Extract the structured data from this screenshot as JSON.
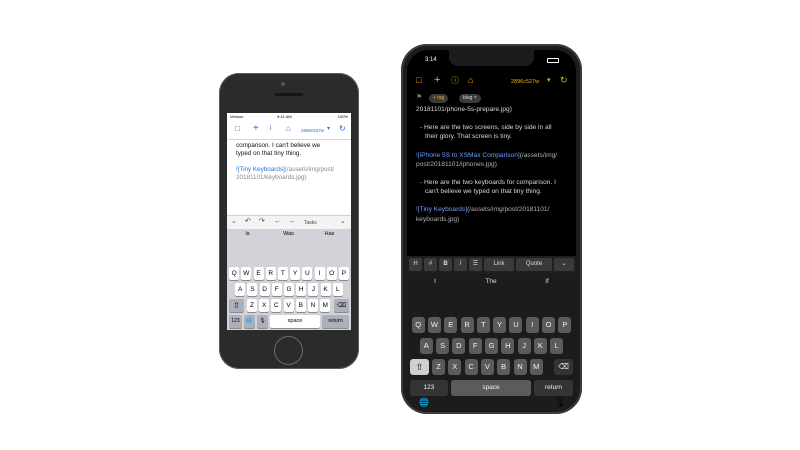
{
  "colors": {
    "accent_blue": "#2b6cd7",
    "accent_gold": "#f0b400",
    "link_dark": "#6f9cff"
  },
  "se": {
    "status": {
      "carrier": "Verizon",
      "time": "9:41 AM",
      "battery": "100%"
    },
    "toolbar": {
      "new": "□",
      "add": "+",
      "info": "i",
      "tag": "⌂",
      "commit": "2896c527w",
      "caret": "▾",
      "sync": "↻"
    },
    "body": {
      "line1": "comparison. I can't believe we",
      "line2": "typed on that tiny thing.",
      "link_text": "![Tiny Keyboards]",
      "link_url": "(/assets/img/post/",
      "link_url2": "20181101/keyboards.jpg)"
    },
    "accessory": {
      "close": "⌄",
      "undo": "↶",
      "redo": "↷",
      "left": "←",
      "right": "→",
      "tasks": "Tasks",
      "more": "⌄"
    },
    "suggestions": [
      "Is",
      "Was",
      "Has"
    ],
    "rows": [
      [
        "Q",
        "W",
        "E",
        "R",
        "T",
        "Y",
        "U",
        "I",
        "O",
        "P"
      ],
      [
        "A",
        "S",
        "D",
        "F",
        "G",
        "H",
        "J",
        "K",
        "L"
      ],
      [
        "Z",
        "X",
        "C",
        "V",
        "B",
        "N",
        "M"
      ]
    ],
    "keys": {
      "shift": "⇧",
      "delete": "⌫",
      "numbers": "123",
      "globe": "🌐",
      "mic": "🎙",
      "space": "space",
      "return": "return"
    }
  },
  "xs": {
    "status": {
      "time": "3:14"
    },
    "toolbar": {
      "new": "□",
      "add": "+",
      "info": "ⓘ",
      "tag": "⌂",
      "commit": "2896c527w",
      "caret": "▾",
      "sync": "↻"
    },
    "tags": {
      "add_tag": "+ tag",
      "blog": "blog",
      "blog_x": "×",
      "flag": "⚑"
    },
    "body": {
      "l1": "20181101/phone-5s-prepare.jpg)",
      "l2": "- Here are the two screens, side by side in all",
      "l3": "their glory. That screen is tiny.",
      "l4_link": "![iPhone 5S to XSMax Comparison]",
      "l4_url": "(/assets/img/",
      "l5": "post/20181101/iphones.jpg)",
      "l6": "- Here are the two keyboards for comparison. I",
      "l7": "can't believe we typed on that tiny thing.",
      "l8_link": "![Tiny Keyboards]",
      "l8_url": "(/assets/img/post/20181101/",
      "l9": "keyboards.jpg)"
    },
    "accessory": {
      "h": "H",
      "hash": "#",
      "bold": "B",
      "italic": "I",
      "list": "☰",
      "link": "Link",
      "quote": "Quote",
      "more": "⌄"
    },
    "suggestions": [
      "I",
      "The",
      "If"
    ],
    "rows": [
      [
        "Q",
        "W",
        "E",
        "R",
        "T",
        "Y",
        "U",
        "I",
        "O",
        "P"
      ],
      [
        "A",
        "S",
        "D",
        "F",
        "G",
        "H",
        "J",
        "K",
        "L"
      ],
      [
        "Z",
        "X",
        "C",
        "V",
        "B",
        "N",
        "M"
      ]
    ],
    "keys": {
      "shift": "⇧",
      "delete": "⌫",
      "numbers": "123",
      "space": "space",
      "return": "return",
      "globe": "🌐",
      "mic": "🎙"
    }
  }
}
